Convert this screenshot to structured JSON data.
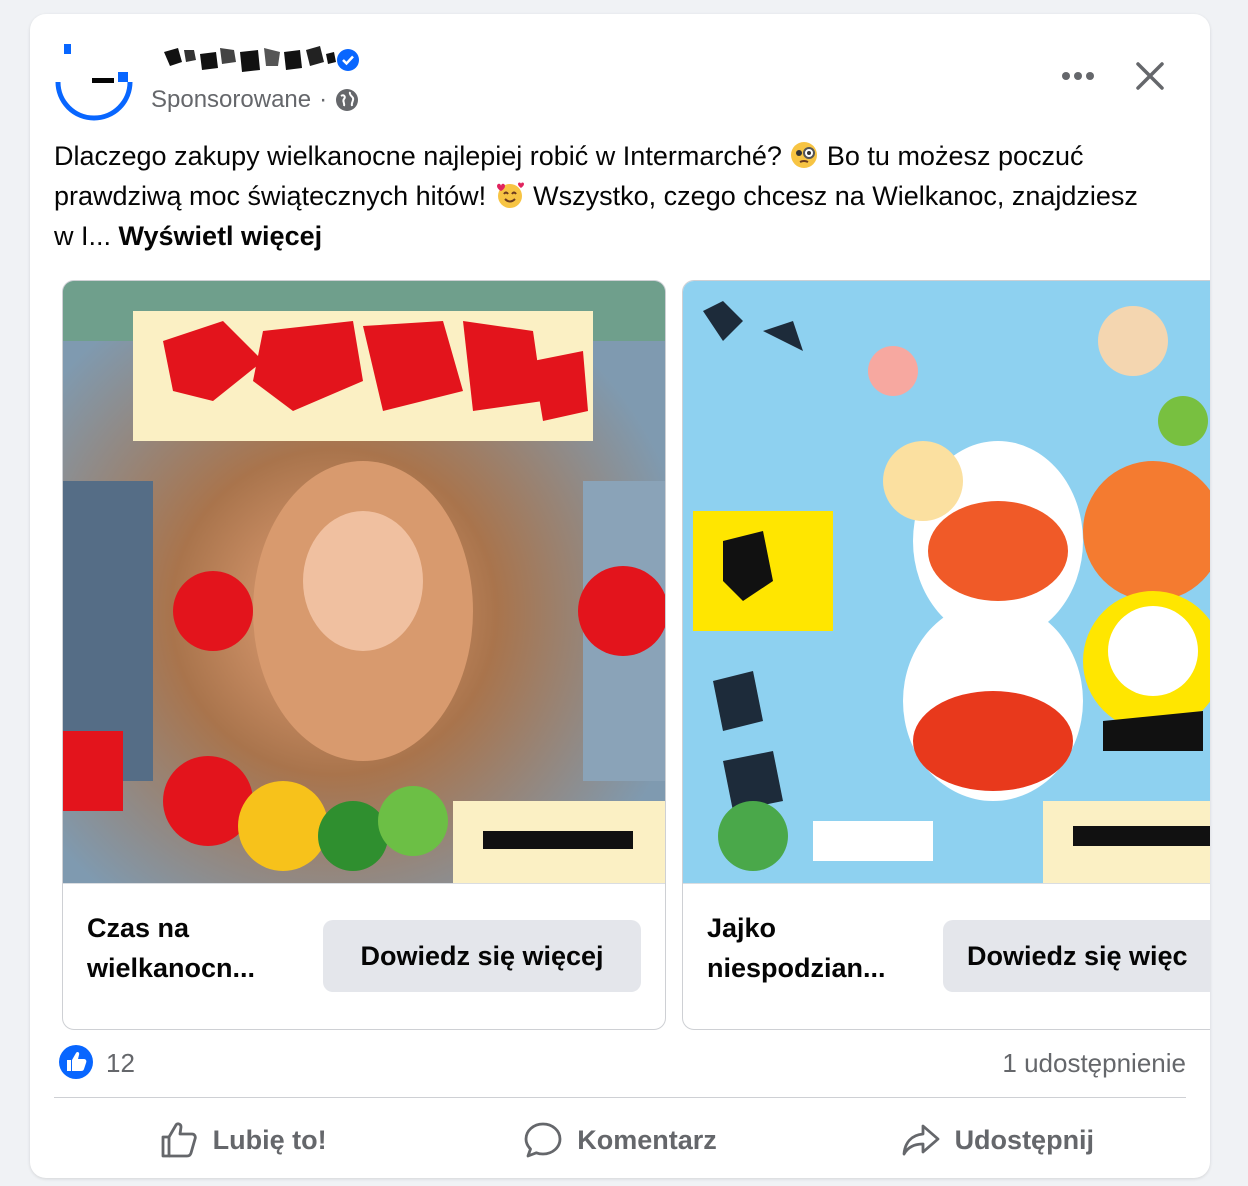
{
  "post": {
    "page_name": "",
    "sponsored_label": "Sponsorowane",
    "separator": "·",
    "text": "Dlaczego zakupy wielkanocne najlepiej robić w Intermarché? 🧐 Bo tu możesz poczuć prawdziwą moc świątecznych hitów! 🥰 Wszystko, czego chcesz na Wielkanoc, znajdziesz w I...",
    "text_parts": {
      "p1": "Dlaczego zakupy wielkanocne najlepiej robić w Intermarché? ",
      "p2": " Bo tu możesz poczuć prawdziwą moc świątecznych hitów! ",
      "p3": " Wszystko, czego chcesz na Wielkanoc, znajdziesz w I... "
    },
    "see_more": "Wyświetl więcej"
  },
  "carousel": [
    {
      "title": "Czas na wielkanocn...",
      "cta": "Dowiedz się więcej"
    },
    {
      "title": "Jajko niespodzian...",
      "cta": "Dowiedz się więc"
    }
  ],
  "stats": {
    "likes": "12",
    "shares": "1 udostępnienie"
  },
  "actions": {
    "like": "Lubię to!",
    "comment": "Komentarz",
    "share": "Udostępnij"
  },
  "colors": {
    "accent": "#0866ff",
    "muted": "#65676b",
    "button_bg": "#e4e6eb"
  },
  "icons": [
    "brand-logo-icon",
    "verified-badge-icon",
    "globe-icon",
    "more-icon",
    "close-icon",
    "like-badge-icon",
    "thumbs-up-icon",
    "comment-icon",
    "share-icon"
  ]
}
